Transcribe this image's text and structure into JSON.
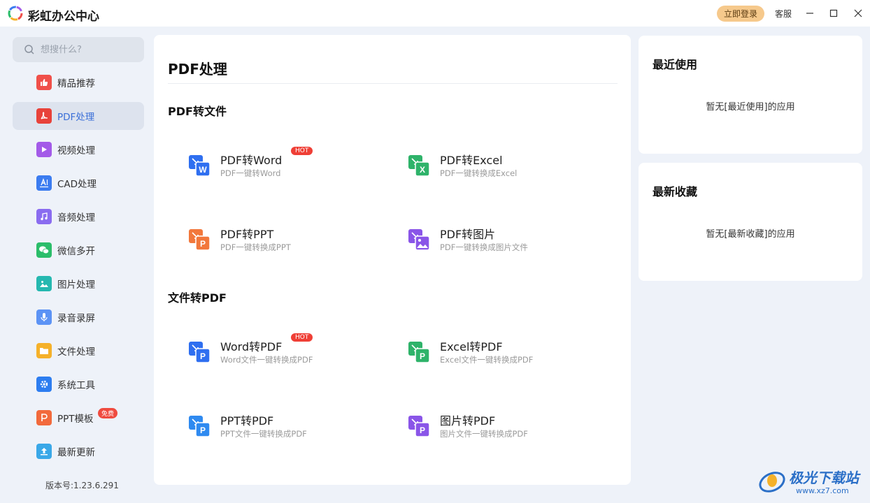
{
  "app": {
    "title": "彩虹办公中心"
  },
  "titlebar": {
    "login_label": "立即登录",
    "service_label": "客服"
  },
  "search": {
    "placeholder": "想搜什么?"
  },
  "sidebar": {
    "items": [
      {
        "label": "精品推荐",
        "icon": "thumbs-up-icon",
        "color": "#f0504a"
      },
      {
        "label": "PDF处理",
        "icon": "pdf-icon",
        "color": "#e8423a"
      },
      {
        "label": "视频处理",
        "icon": "play-icon",
        "color": "#a35be8"
      },
      {
        "label": "CAD处理",
        "icon": "cad-icon",
        "color": "#3b7cf0"
      },
      {
        "label": "音频处理",
        "icon": "music-icon",
        "color": "#8a6cf0"
      },
      {
        "label": "微信多开",
        "icon": "wechat-icon",
        "color": "#2bbd6a"
      },
      {
        "label": "图片处理",
        "icon": "image-icon",
        "color": "#25b8b0"
      },
      {
        "label": "录音录屏",
        "icon": "microphone-icon",
        "color": "#5c93f5"
      },
      {
        "label": "文件处理",
        "icon": "folder-icon",
        "color": "#f5b12a"
      },
      {
        "label": "系统工具",
        "icon": "gear-icon",
        "color": "#2d7df0"
      },
      {
        "label": "PPT模板",
        "icon": "ppt-icon",
        "color": "#f26a3c",
        "badge": "免费"
      },
      {
        "label": "最新更新",
        "icon": "upload-icon",
        "color": "#3aa8e8"
      }
    ],
    "version": "版本号:1.23.6.291"
  },
  "main": {
    "title": "PDF处理",
    "sections": [
      {
        "title": "PDF转文件",
        "tools": [
          {
            "name": "PDF转Word",
            "desc": "PDF一键转Word",
            "badge": "HOT",
            "icon": "pdf-to-word-icon",
            "letter": "W",
            "color": "#2f6ff0"
          },
          {
            "name": "PDF转Excel",
            "desc": "PDF一键转换成Excel",
            "icon": "pdf-to-excel-icon",
            "letter": "X",
            "color": "#2fb36a"
          },
          {
            "name": "PDF转PPT",
            "desc": "PDF一键转换成PPT",
            "icon": "pdf-to-ppt-icon",
            "letter": "P",
            "color": "#f2783c"
          },
          {
            "name": "PDF转图片",
            "desc": "PDF一键转换成图片文件",
            "icon": "pdf-to-image-icon",
            "letter": "",
            "color": "#8a55e8"
          }
        ]
      },
      {
        "title": "文件转PDF",
        "tools": [
          {
            "name": "Word转PDF",
            "desc": "Word文件一键转换成PDF",
            "badge": "HOT",
            "icon": "word-to-pdf-icon",
            "letter": "P",
            "color": "#2f6ff0"
          },
          {
            "name": "Excel转PDF",
            "desc": "Excel文件一键转换成PDF",
            "icon": "excel-to-pdf-icon",
            "letter": "P",
            "color": "#2fb36a"
          },
          {
            "name": "PPT转PDF",
            "desc": "PPT文件一键转换成PDF",
            "icon": "ppt-to-pdf-icon",
            "letter": "P",
            "color": "#2f8af0"
          },
          {
            "name": "图片转PDF",
            "desc": "图片文件一键转换成PDF",
            "icon": "image-to-pdf-icon",
            "letter": "P",
            "color": "#8a55e8"
          }
        ]
      }
    ]
  },
  "recent": {
    "title": "最近使用",
    "empty": "暂无[最近使用]的应用"
  },
  "favorites": {
    "title": "最新收藏",
    "empty": "暂无[最新收藏]的应用"
  },
  "watermark": {
    "text": "极光下载站",
    "url": "www.xz7.com"
  }
}
